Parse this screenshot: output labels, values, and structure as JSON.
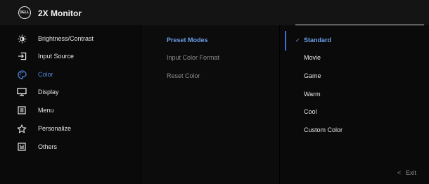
{
  "header": {
    "title": "2X Monitor",
    "logo_text": "DELL"
  },
  "menu": [
    {
      "label": "Brightness/Contrast",
      "icon": "brightness-icon"
    },
    {
      "label": "Input Source",
      "icon": "input-source-icon"
    },
    {
      "label": "Color",
      "icon": "color-palette-icon",
      "active": true
    },
    {
      "label": "Display",
      "icon": "display-icon"
    },
    {
      "label": "Menu",
      "icon": "menu-icon"
    },
    {
      "label": "Personalize",
      "icon": "star-icon"
    },
    {
      "label": "Others",
      "icon": "others-icon"
    }
  ],
  "submenu": [
    {
      "label": "Preset Modes",
      "state": "active"
    },
    {
      "label": "Input Color Format",
      "state": "dim"
    },
    {
      "label": "Reset Color",
      "state": "dim"
    }
  ],
  "options": [
    {
      "label": "Standard",
      "selected": true
    },
    {
      "label": "Movie"
    },
    {
      "label": "Game"
    },
    {
      "label": "Warm"
    },
    {
      "label": "Cool"
    },
    {
      "label": "Custom Color"
    }
  ],
  "footer": {
    "exit_label": "Exit",
    "exit_glyph": "<"
  },
  "colors": {
    "accent": "#4f86d9",
    "background": "#000000",
    "text": "#e6e6e6"
  }
}
